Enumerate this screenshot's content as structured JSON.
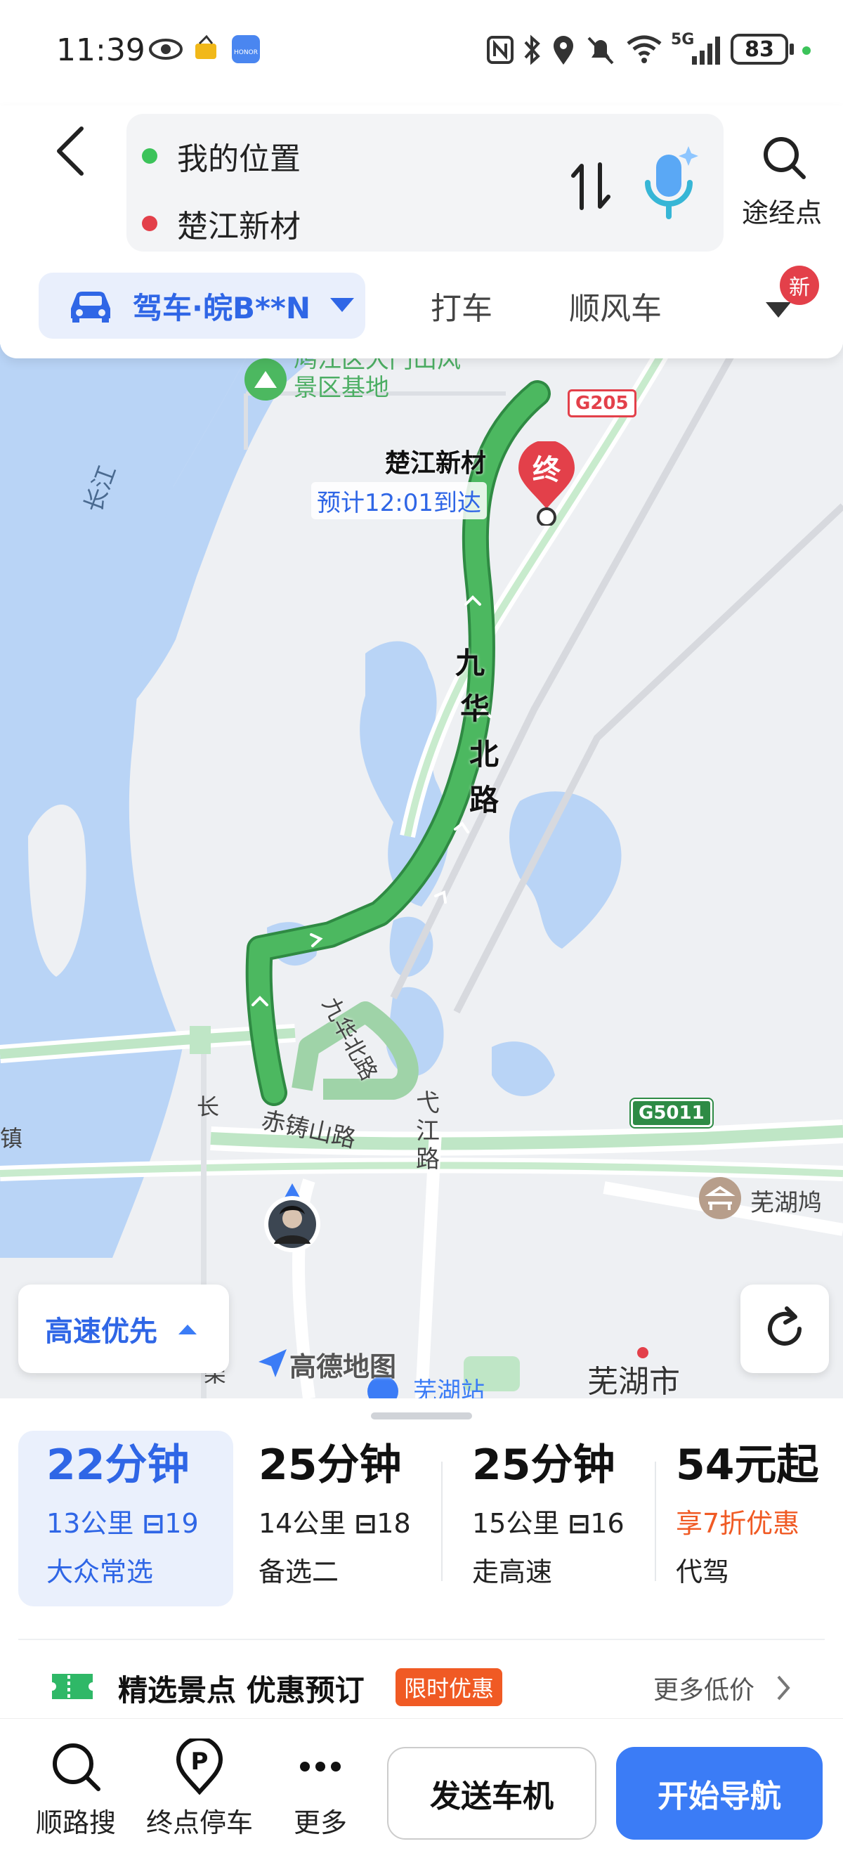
{
  "status_bar": {
    "time": "11:39",
    "network": "5G",
    "battery": "83"
  },
  "route_input": {
    "origin": "我的位置",
    "destination": "楚江新材",
    "waypoint_label": "途经点"
  },
  "mode_tabs": {
    "drive": "驾车·皖B**N",
    "taxi": "打车",
    "carpool": "顺风车",
    "new_badge": "新"
  },
  "map": {
    "dest_label": "楚江新材",
    "dest_marker": "终",
    "eta_text": "预计12:01到达",
    "road_main": [
      "九",
      "华",
      "北",
      "路"
    ],
    "road_small": "九华北路",
    "road_chizhushan": "赤铸山路",
    "road_yijiang": "弋江路",
    "river": "长江",
    "scenic": "鸠江区大门山风景区基地",
    "wuhu_city": "芜湖市",
    "wuhu_jiu": "芜湖鸠",
    "station": "芜湖站",
    "left_chang": "长",
    "left_jia": "架",
    "left_zhen": "镇",
    "g205": "G205",
    "g5011": "G5011",
    "logo": "高德地图",
    "pref": "高速优先"
  },
  "routes": [
    {
      "time": "22分钟",
      "dist": "13公里",
      "lights": "19",
      "note": "大众常选"
    },
    {
      "time": "25分钟",
      "dist": "14公里",
      "lights": "18",
      "note": "备选二"
    },
    {
      "time": "25分钟",
      "dist": "15公里",
      "lights": "16",
      "note": "走高速"
    },
    {
      "time": "54元起",
      "promo": "享7折优惠",
      "note": "代驾"
    }
  ],
  "promo_banner": {
    "title": "精选景点 优惠预订",
    "tag": "限时优惠",
    "more": "更多低价"
  },
  "bottom_bar": {
    "search_along": "顺路搜",
    "parking": "终点停车",
    "more": "更多",
    "send_car": "发送车机",
    "start_nav": "开始导航"
  },
  "colors": {
    "route_green": "#4cb860",
    "accent_blue": "#2f66e6",
    "dest_red": "#e3404a",
    "promo_orange": "#f05a24",
    "water": "#bdd7f5"
  }
}
